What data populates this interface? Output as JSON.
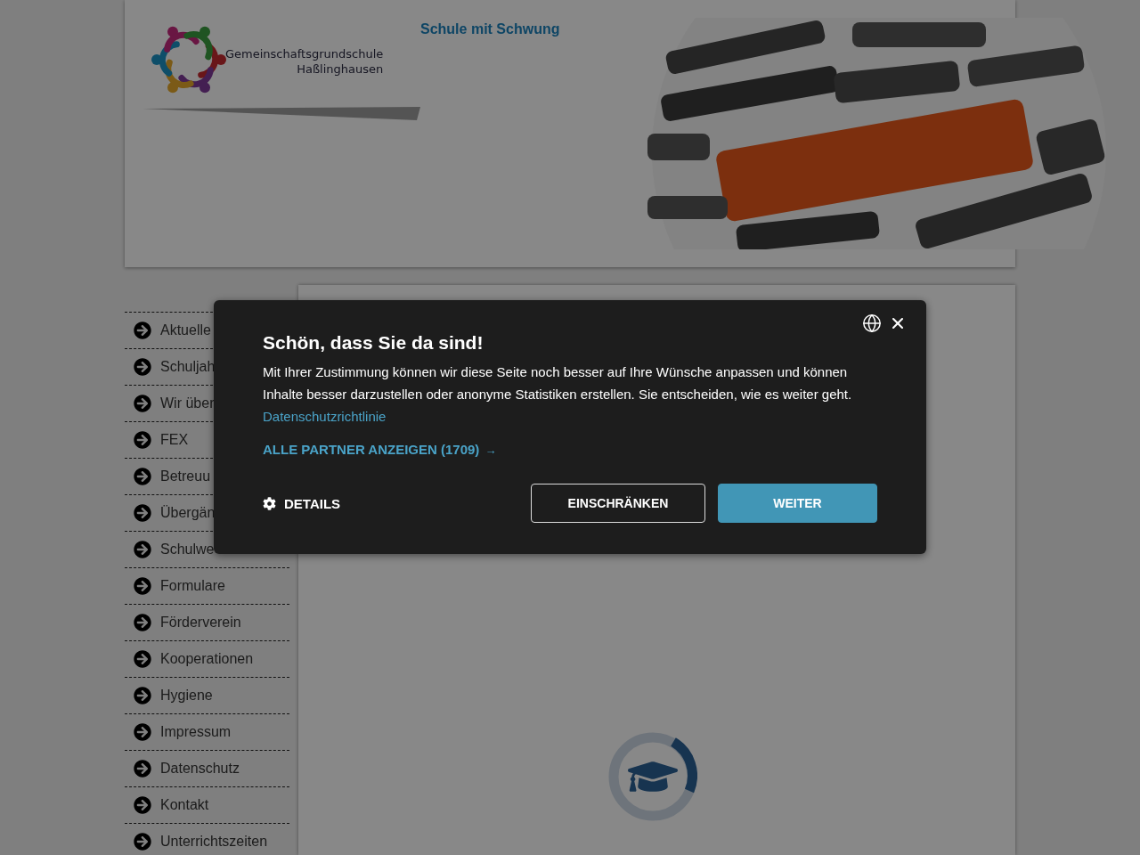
{
  "header": {
    "logo_line_1": "Gemeinschaftsgrundschule",
    "logo_line_2": "Haßlinghausen",
    "tagline": "Schule mit Schwung"
  },
  "nav": [
    {
      "label": "Aktuelle"
    },
    {
      "label": "Schuljah"
    },
    {
      "label": "Wir über"
    },
    {
      "label": "FEX"
    },
    {
      "label": "Betreuu"
    },
    {
      "label": "Übergän"
    },
    {
      "label": "Schulwe"
    },
    {
      "label": "Formulare"
    },
    {
      "label": "Förderverein"
    },
    {
      "label": "Kooperationen"
    },
    {
      "label": "Hygiene"
    },
    {
      "label": "Impressum"
    },
    {
      "label": "Datenschutz"
    },
    {
      "label": "Kontakt"
    },
    {
      "label": "Unterrichtszeiten"
    }
  ],
  "consent": {
    "title": "Schön, dass Sie da sind!",
    "text": "Mit Ihrer Zustimmung können wir diese Seite noch besser auf Ihre Wünsche anpassen und können Inhalte besser darzustellen oder anonyme Statistiken erstellen. Sie entscheiden, wie es weiter geht.",
    "privacy_link": "Datenschutzrichtlinie",
    "partners_link": "ALLE PARTNER ANZEIGEN (1709)",
    "partners_arrow": "→",
    "details": "DETAILS",
    "buttons": [
      {
        "kind": "outline",
        "label": "EINSCHRÄNKEN"
      },
      {
        "kind": "primary",
        "label": "WEITER"
      }
    ]
  }
}
